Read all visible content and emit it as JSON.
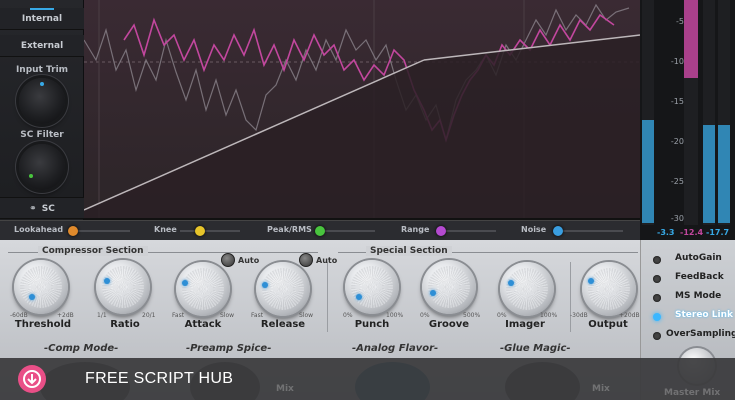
{
  "left_panel": {
    "sources": [
      "Internal",
      "External"
    ],
    "input_trim_label": "Input Trim",
    "sc_filter_label": "SC Filter",
    "sc_label": "SC"
  },
  "meter": {
    "ticks": [
      "-5",
      "-10",
      "-15",
      "-20",
      "-25",
      "-30"
    ],
    "readouts": [
      "-3.3",
      "-12.4",
      "-17.7"
    ],
    "colors": {
      "cyan": "#37a9e6",
      "magenta": "#c2479e"
    }
  },
  "param_strip": [
    {
      "label": "Lookahead",
      "color": "#e08a2c"
    },
    {
      "label": "Knee",
      "color": "#e6c42a"
    },
    {
      "label": "Peak/RMS",
      "color": "#49c43e"
    },
    {
      "label": "Range",
      "color": "#b44ad0"
    },
    {
      "label": "Noise",
      "color": "#3a9ee0"
    }
  ],
  "sections": {
    "compressor": "Compressor Section",
    "special": "Special Section"
  },
  "knobs": [
    {
      "name": "Threshold",
      "min": "-60dB",
      "max": "+2dB"
    },
    {
      "name": "Ratio",
      "min": "1/1",
      "max": "20/1"
    },
    {
      "name": "Attack",
      "min": "Fast",
      "max": "Slow"
    },
    {
      "name": "Release",
      "min": "Fast",
      "max": "Slow"
    },
    {
      "name": "Punch",
      "min": "0%",
      "max": "100%"
    },
    {
      "name": "Groove",
      "min": "0%",
      "max": "500%"
    },
    {
      "name": "Imager",
      "min": "0%",
      "max": "100%"
    },
    {
      "name": "Output",
      "min": "-30dB",
      "max": "+20dB"
    }
  ],
  "auto_label": "Auto",
  "modes": [
    "-Comp Mode-",
    "-Preamp Spice-",
    "-Analog Flavor-",
    "-Glue Magic-"
  ],
  "options": [
    {
      "label": "AutoGain",
      "on": false
    },
    {
      "label": "FeedBack",
      "on": false
    },
    {
      "label": "MS Mode",
      "on": false
    },
    {
      "label": "Stereo Link",
      "on": true
    },
    {
      "label": "OverSampling",
      "on": false
    }
  ],
  "ghost": {
    "left": "Mix",
    "right": "Mix",
    "master": "Master Mix"
  },
  "banner": {
    "text": "FREE SCRIPT HUB",
    "accent": "#e94f87"
  }
}
